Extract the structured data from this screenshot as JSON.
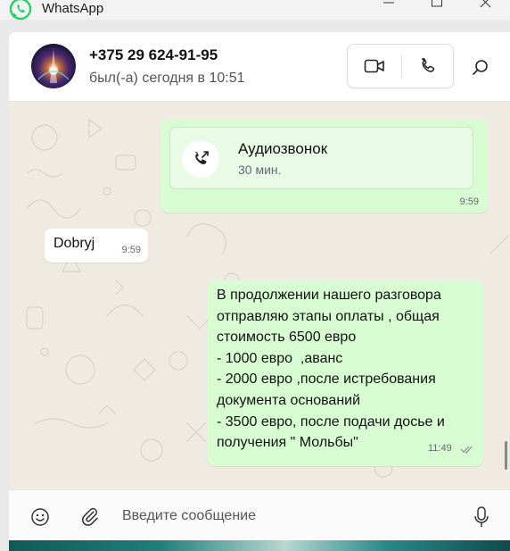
{
  "window": {
    "app_name": "WhatsApp",
    "controls": [
      "minimize-icon",
      "maximize-icon",
      "close-icon"
    ]
  },
  "header": {
    "contact_name": "+375 29 624-91-95",
    "status": "был(-а) сегодня в 10:51",
    "icons": [
      "video-call-icon",
      "voice-call-icon",
      "search-icon"
    ]
  },
  "messages": {
    "call": {
      "title": "Аудиозвонок",
      "duration": "30 мин.",
      "time": "9:59",
      "icon": "outgoing-call-icon"
    },
    "incoming": {
      "text": "Dobryj",
      "time": "9:59"
    },
    "outgoing": {
      "lines": [
        "В продолжении нашего разговора",
        "отправляю этапы оплаты , общая",
        "стоимость 6500 евро",
        "- 1000 евро  ,аванс",
        "- 2000 евро ,после истребования",
        "документа оснований",
        "- 3500 евро, после подачи досье и",
        "получения \" Мольбы\""
      ],
      "time": "11:49",
      "status_icon": "double-check-icon"
    }
  },
  "composer": {
    "placeholder": "Введите сообщение",
    "icons": [
      "emoji-icon",
      "attach-icon",
      "microphone-icon"
    ]
  },
  "colors": {
    "outgoing_bubble": "#d9fdd3",
    "incoming_bubble": "#ffffff",
    "chat_background": "#efeae2",
    "brand_green": "#25d366"
  }
}
